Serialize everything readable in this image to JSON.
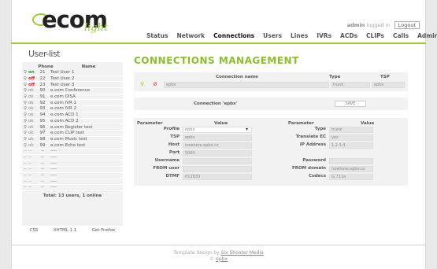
{
  "brand": {
    "main": "ecom",
    "sub": "light"
  },
  "login": {
    "user": "admin",
    "text": "logged in",
    "button": "Logout"
  },
  "nav": [
    {
      "label": "Status"
    },
    {
      "label": "Network"
    },
    {
      "label": "Connections",
      "active": true
    },
    {
      "label": "Users"
    },
    {
      "label": "Lines"
    },
    {
      "label": "IVRs"
    },
    {
      "label": "ACDs"
    },
    {
      "label": "CLIPs"
    },
    {
      "label": "Calls"
    },
    {
      "label": "Admin"
    }
  ],
  "sidebar": {
    "title": "User-list",
    "headers": {
      "phone": "Phone",
      "name": "Name"
    },
    "users": [
      {
        "status": "on",
        "num": "21",
        "name": "Test User 1"
      },
      {
        "status": "off",
        "num": "22",
        "name": "Test User 2"
      },
      {
        "status": "off",
        "num": "23",
        "name": "Test User 3"
      },
      {
        "status": "ok",
        "num": "90",
        "name": "e.com Conference"
      },
      {
        "status": "ok",
        "num": "91",
        "name": "e.com DISA"
      },
      {
        "status": "ok",
        "num": "92",
        "name": "e.com IVR 1"
      },
      {
        "status": "ok",
        "num": "93",
        "name": "e.com IVR 2"
      },
      {
        "status": "ok",
        "num": "94",
        "name": "e.com ACD 1"
      },
      {
        "status": "ok",
        "num": "95",
        "name": "e.com ACD 2"
      },
      {
        "status": "ok",
        "num": "96",
        "name": "e.com Register test"
      },
      {
        "status": "ok",
        "num": "97",
        "name": "e.com CLIP test"
      },
      {
        "status": "ok",
        "num": "98",
        "name": "e.com Music test"
      },
      {
        "status": "ok",
        "num": "99",
        "name": "e.com Echo test"
      },
      {
        "status": "--",
        "num": "--",
        "name": "----"
      },
      {
        "status": "--",
        "num": "--",
        "name": "----"
      },
      {
        "status": "--",
        "num": "--",
        "name": "----"
      },
      {
        "status": "--",
        "num": "--",
        "name": "----"
      },
      {
        "status": "--",
        "num": "--",
        "name": "----"
      },
      {
        "status": "--",
        "num": "--",
        "name": "----"
      },
      {
        "status": "--",
        "num": "--",
        "name": "----"
      }
    ],
    "total": "Total: 13 users, 1 online",
    "footer": [
      "CSS",
      "XHTML 1.1",
      "Get Firefox"
    ]
  },
  "main": {
    "title": "CONNECTIONS MANAGEMENT",
    "list_headers": {
      "name": "Connection name",
      "type": "Type",
      "tsp": "TSP"
    },
    "connections": [
      {
        "name": "epbx",
        "type": "trunk",
        "tsp": "epbx"
      }
    ],
    "edit_title": "Connection 'epbx'",
    "save": "SAVE",
    "param_headers": {
      "param": "Parameter",
      "value": "Value"
    },
    "left": [
      {
        "label": "Profile",
        "value": "epbx"
      },
      {
        "label": "TSP",
        "value": "epbx"
      },
      {
        "label": "Host",
        "value": "nowhere.epbx.cz"
      },
      {
        "label": "Port",
        "value": "5060"
      },
      {
        "label": "Username",
        "value": ""
      },
      {
        "label": "FROM user",
        "value": ""
      },
      {
        "label": "DTMF",
        "value": "rfc2833"
      }
    ],
    "right": [
      {
        "label": "Type",
        "value": "trunk"
      },
      {
        "label": "Translate EC",
        "value": "yes"
      },
      {
        "label": "IP Address",
        "value": "1.2.3.4"
      },
      {
        "label": "",
        "value": ""
      },
      {
        "label": "Password",
        "value": ""
      },
      {
        "label": "FROM domain",
        "value": "nowhere.epbx.cz"
      },
      {
        "label": "Codecs",
        "value": "G.711a"
      }
    ]
  },
  "footer": {
    "line1": "Template design by",
    "link1": "Six Shooter Media",
    "line2": "©",
    "link2": "epbx"
  },
  "colors": {
    "accent": "#9ccc3a",
    "title": "#8bbf2e",
    "on": "#1f9c1f",
    "off": "#d22222"
  }
}
